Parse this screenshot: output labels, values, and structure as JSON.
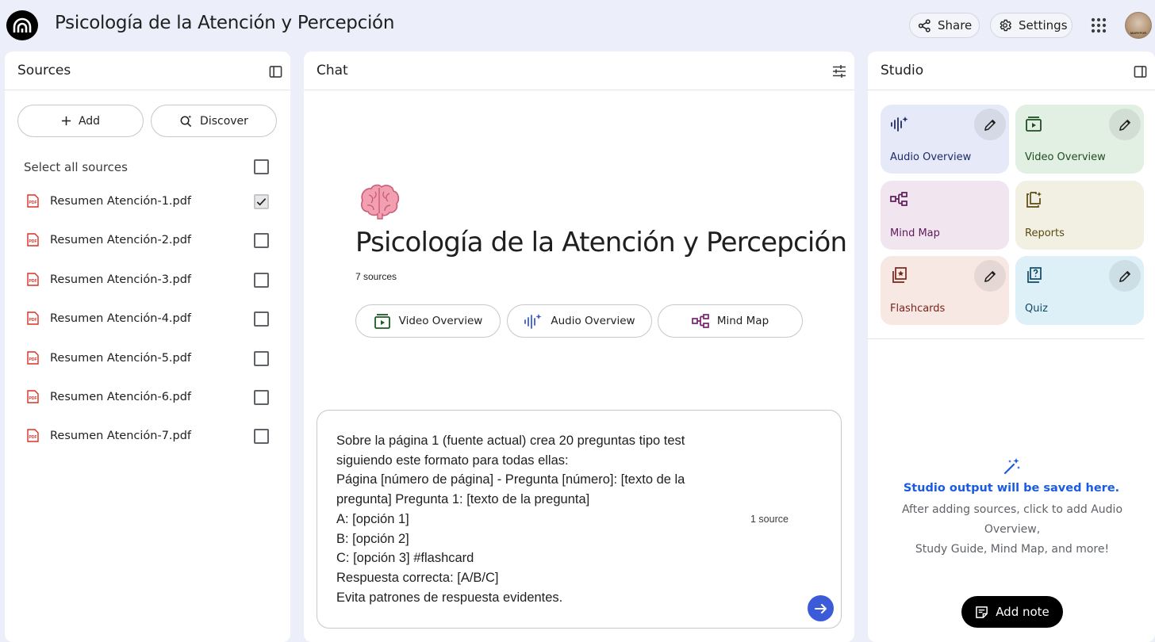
{
  "header": {
    "title": "Psicología de la Atención y Percepción",
    "share_label": "Share",
    "settings_label": "Settings",
    "avatar_text": "MARYPOR"
  },
  "sources": {
    "title": "Sources",
    "add_label": "Add",
    "discover_label": "Discover",
    "select_all_label": "Select all sources",
    "select_all_checked": false,
    "items": [
      {
        "name": "Resumen Atención-1.pdf",
        "checked": true
      },
      {
        "name": "Resumen Atención-2.pdf",
        "checked": false
      },
      {
        "name": "Resumen Atención-3.pdf",
        "checked": false
      },
      {
        "name": "Resumen Atención-4.pdf",
        "checked": false
      },
      {
        "name": "Resumen Atención-5.pdf",
        "checked": false
      },
      {
        "name": "Resumen Atención-6.pdf",
        "checked": false
      },
      {
        "name": "Resumen Atención-7.pdf",
        "checked": false
      }
    ]
  },
  "chat": {
    "title": "Chat",
    "notebook_title": "Psicología de la Atención y Percepción",
    "source_count": "7 sources",
    "quick_actions": [
      {
        "label": "Video Overview"
      },
      {
        "label": "Audio Overview"
      },
      {
        "label": "Mind Map"
      }
    ],
    "composer_text": "Sobre la página 1 (fuente actual) crea 20 preguntas tipo test\nsiguiendo este formato para todas ellas:\nPágina [número de página] - Pregunta [número]: [texto de la\npregunta] Pregunta 1: [texto de la pregunta]\nA: [opción 1]\nB: [opción 2]\nC: [opción 3] #flashcard\nRespuesta correcta: [A/B/C]\nEvita patrones de respuesta evidentes.",
    "composer_source_count": "1 source"
  },
  "studio": {
    "title": "Studio",
    "tiles": [
      {
        "label": "Audio Overview"
      },
      {
        "label": "Video Overview"
      },
      {
        "label": "Mind Map"
      },
      {
        "label": "Reports"
      },
      {
        "label": "Flashcards"
      },
      {
        "label": "Quiz"
      }
    ],
    "empty_title": "Studio output will be saved here.",
    "empty_desc_line1": "After adding sources, click to add Audio Overview,",
    "empty_desc_line2": "Study Guide, Mind Map, and more!",
    "add_note_label": "Add note"
  },
  "colors": {
    "background": "#eceef9",
    "accent_blue": "#1a5be0",
    "send_button": "#3b5bd9",
    "pdf_red": "#d93025"
  },
  "icons": [
    "notebooklm-logo-icon",
    "share-icon",
    "gear-icon",
    "apps-grid-icon",
    "panel-collapse-icon",
    "plus-icon",
    "discover-icon",
    "pdf-icon",
    "check-icon",
    "tune-icon",
    "brain-emoji-icon",
    "video-icon",
    "audio-sparkle-icon",
    "mind-map-icon",
    "arrow-right-icon",
    "pencil-icon",
    "reports-icon",
    "flashcards-icon",
    "quiz-icon",
    "magic-wand-icon",
    "note-icon"
  ]
}
